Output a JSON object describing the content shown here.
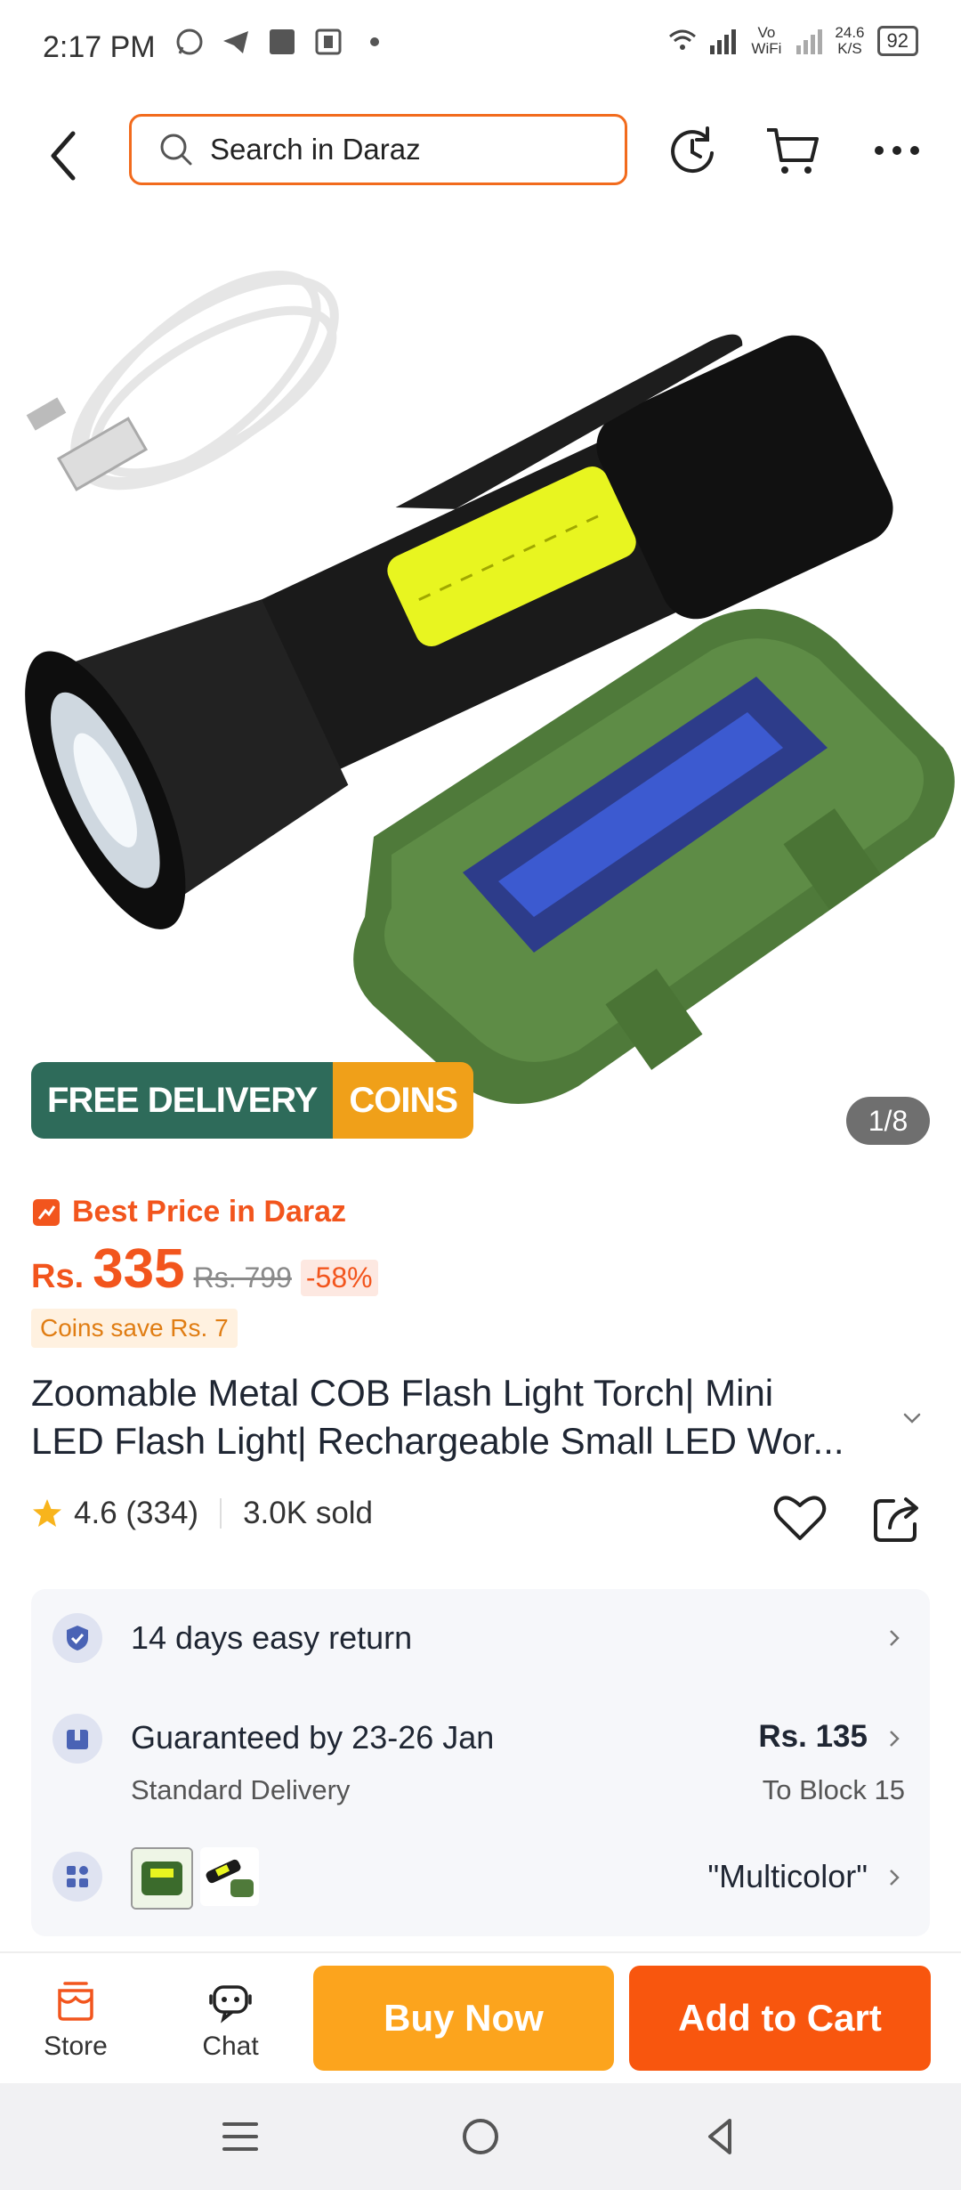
{
  "status_bar": {
    "time": "2:17 PM",
    "network_speed_value": "24.6",
    "network_speed_unit": "K/S",
    "vowifi": "Vo WiFi",
    "battery": "92",
    "icons": [
      "whatsapp-icon",
      "telegram-icon",
      "square-icon",
      "app-icon",
      "dot-icon",
      "wifi-icon",
      "signal-icon"
    ]
  },
  "header": {
    "search_placeholder": "Search in Daraz",
    "icons": [
      "back-arrow-icon",
      "search-icon",
      "history-icon",
      "cart-icon",
      "more-icon"
    ]
  },
  "gallery": {
    "badge_free": "FREE DELIVERY",
    "badge_coins": "COINS",
    "page_counter": "1/8"
  },
  "price": {
    "best_price_label": "Best Price in Daraz",
    "currency": "Rs.",
    "current": "335",
    "original": "Rs. 799",
    "discount": "-58%",
    "coins_save": "Coins save Rs. 7"
  },
  "product": {
    "title_line1": "Zoomable Metal COB Flash Light Torch| Mini",
    "title_line2": "LED Flash Light| Rechargeable Small LED Wor...",
    "rating": "4.6 (334)",
    "sold": "3.0K sold"
  },
  "info": {
    "return_text": "14 days easy return",
    "delivery_text": "Guaranteed by 23-26 Jan",
    "delivery_sub": "Standard Delivery",
    "delivery_price": "Rs. 135",
    "delivery_dest": "To Block 15",
    "variant_name": "\"Multicolor\""
  },
  "bottom": {
    "store_label": "Store",
    "chat_label": "Chat",
    "buy_now": "Buy Now",
    "add_to_cart": "Add to Cart"
  },
  "colors": {
    "brand_orange": "#f8560e",
    "buy_now_yellow": "#fca41d",
    "free_delivery_green": "#2e6b5a",
    "coins_gold": "#f0a019"
  }
}
